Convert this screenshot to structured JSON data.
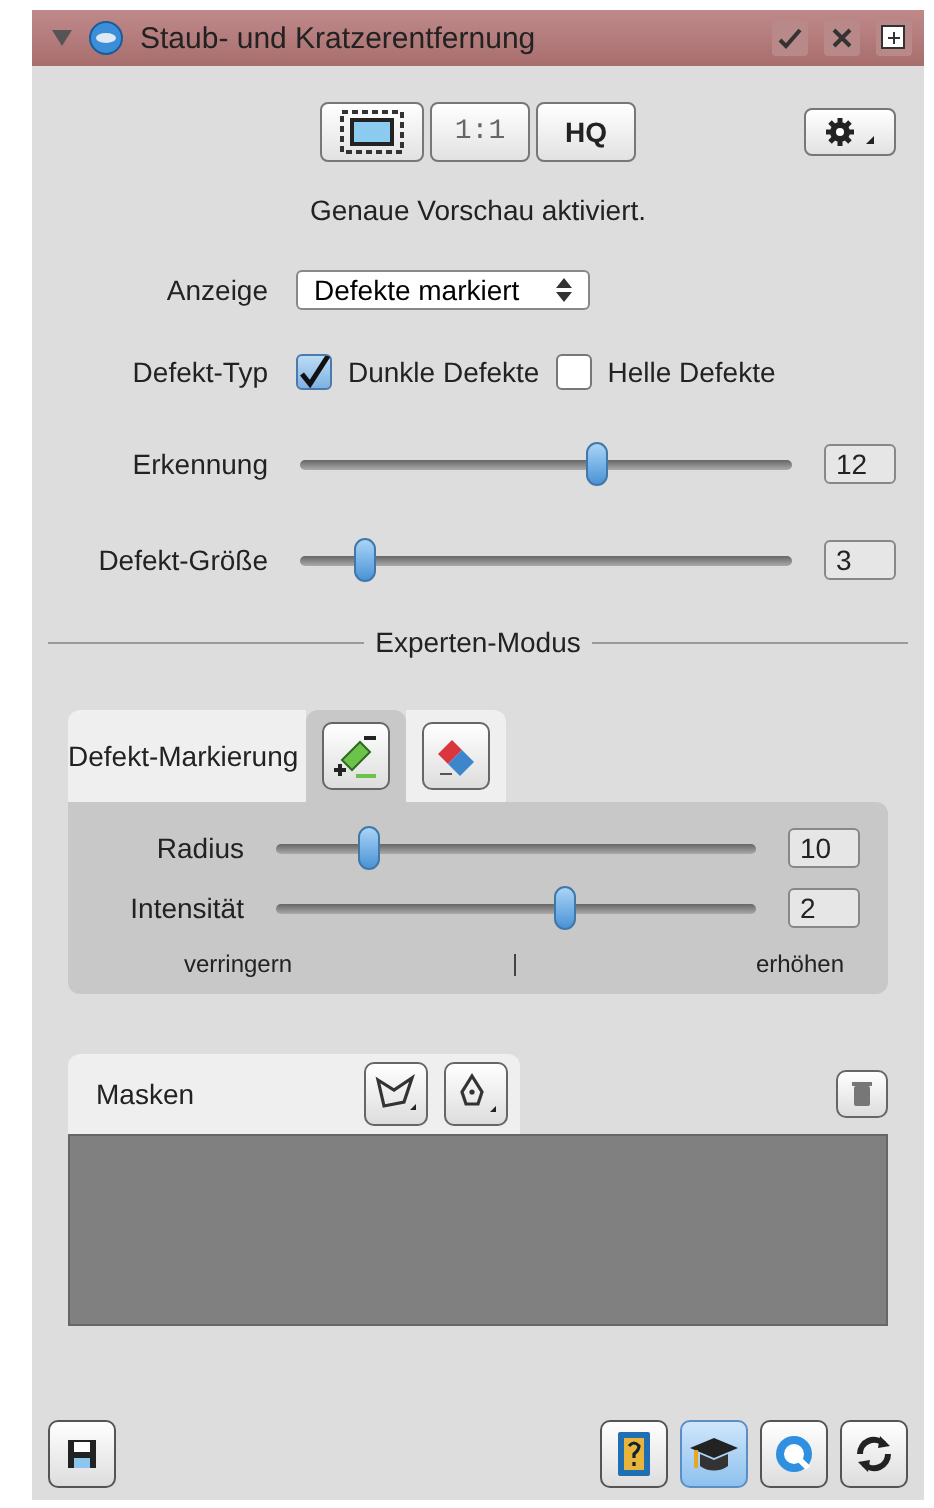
{
  "panel": {
    "title": "Staub- und Kratzerentfernung"
  },
  "preview_buttons": [
    {
      "kind": "fit"
    },
    {
      "kind": "text",
      "label": "1:1"
    },
    {
      "kind": "text",
      "label": "HQ"
    }
  ],
  "status": "Genaue Vorschau aktiviert.",
  "display": {
    "label": "Anzeige",
    "value": "Defekte markiert"
  },
  "defect_type": {
    "label": "Defekt-Typ",
    "options": [
      {
        "label": "Dunkle Defekte",
        "checked": true
      },
      {
        "label": "Helle Defekte",
        "checked": false
      }
    ]
  },
  "sliders": [
    {
      "label": "Erkennung",
      "level": 0.6,
      "value": "12"
    },
    {
      "label": "Defekt-Größe",
      "level": 0.13,
      "value": "3"
    }
  ],
  "expert_mode": {
    "label": "Experten-Modus"
  },
  "marking": {
    "title": "Defekt-Markierung",
    "tools": [
      {
        "kind": "add",
        "selected": true
      },
      {
        "kind": "erase",
        "selected": false
      }
    ],
    "sliders": [
      {
        "label": "Radius",
        "level": 0.19,
        "value": "10"
      },
      {
        "label": "Intensität",
        "level": 0.6,
        "value": "2"
      }
    ],
    "scale": {
      "left": "verringern",
      "right": "erhöhen"
    }
  },
  "masks": {
    "title": "Masken"
  },
  "footer": [
    {
      "kind": "save",
      "selected": false
    },
    {
      "kind": "help",
      "selected": false
    },
    {
      "kind": "tutorial",
      "selected": true
    },
    {
      "kind": "quick",
      "selected": false
    },
    {
      "kind": "refresh",
      "selected": false
    }
  ]
}
